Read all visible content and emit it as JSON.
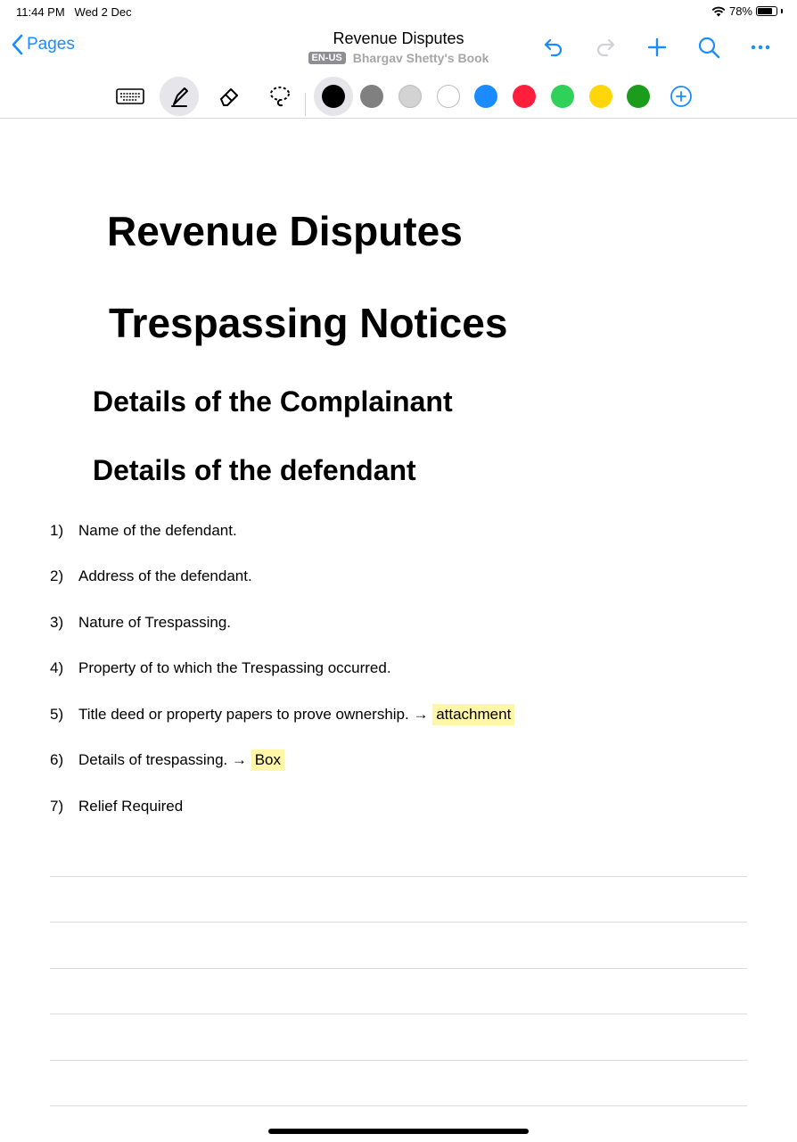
{
  "status": {
    "time": "11:44 PM",
    "date": "Wed 2 Dec",
    "battery": "78%",
    "battery_level": 0.78
  },
  "nav": {
    "back_label": "Pages",
    "title": "Revenue Disputes",
    "lang_badge": "EN-US",
    "book_name": "Bhargav Shetty's Book",
    "actions": [
      "undo-icon",
      "redo-icon",
      "plus-icon",
      "search-icon",
      "more-icon"
    ]
  },
  "toolbar": {
    "tools": [
      "keyboard-icon",
      "pen-icon",
      "eraser-icon",
      "lasso-icon"
    ],
    "selected_tool": "pen-icon",
    "colors": [
      "#000000",
      "#808080",
      "#d3d3d3",
      "#ffffff",
      "#1a8cff",
      "#ff1f3d",
      "#30d158",
      "#ffd60a",
      "#1c9c1c"
    ],
    "selected_color": "#000000",
    "add_color_icon": "add-circle-icon"
  },
  "document": {
    "heading1": "Revenue Disputes",
    "heading2": "Trespassing Notices",
    "heading3a": "Details of the Complainant",
    "heading3b": "Details of the defendant",
    "list": [
      {
        "num": "1)",
        "text": "Name of the defendant."
      },
      {
        "num": "2)",
        "text": "Address of the defendant."
      },
      {
        "num": "3)",
        "text": "Nature of Trespassing."
      },
      {
        "num": "4)",
        "text": "Property of to which the Trespassing occurred."
      },
      {
        "num": "5)",
        "text": "Title deed or property papers to prove ownership. → ",
        "highlight": "attachment"
      },
      {
        "num": "6)",
        "text": "Details of trespassing. → ",
        "highlight": "Box"
      },
      {
        "num": "7)",
        "text": "Relief Required"
      }
    ]
  }
}
